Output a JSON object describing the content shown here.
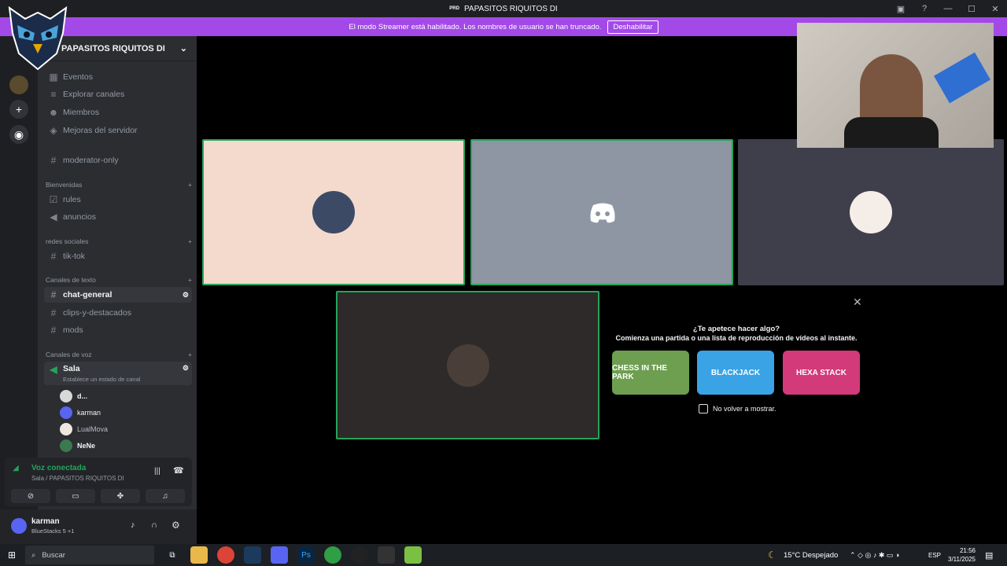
{
  "title": {
    "badge": "PRD",
    "text": "PAPASITOS RIQUITOS DI"
  },
  "streamer": {
    "message": "El modo Streamer está habilitado. Los nombres de usuario se han truncado.",
    "button": "Deshabilitar"
  },
  "server": {
    "name": "PAPASITOS RIQUITOS DI"
  },
  "nav": [
    {
      "label": "Eventos",
      "icon": "calendar-icon"
    },
    {
      "label": "Explorar canales",
      "icon": "list-icon"
    },
    {
      "label": "Miembros",
      "icon": "members-icon"
    },
    {
      "label": "Mejoras del servidor",
      "icon": "boost-icon"
    }
  ],
  "channels": {
    "moderator": "moderator-only",
    "cat_bienvenidas": "Bienvenidas",
    "rules": "rules",
    "anuncios": "anuncios",
    "cat_redes": "redes sociales",
    "tiktok": "tik-tok",
    "cat_texto": "Canales de texto",
    "chat_general": "chat-general",
    "clips": "clips-y-destacados",
    "mods": "mods",
    "cat_voz": "Canales de voz",
    "sala": "Sala",
    "sala_status": "Establece un estado de canal"
  },
  "voice_users": [
    "d...",
    "karman",
    "LualMova",
    "NeNe"
  ],
  "voice_panel": {
    "status": "Voz conectada",
    "location": "Sala / PAPASITOS RIQUITOS DI"
  },
  "user_panel": {
    "name": "karman",
    "activity": "BlueStacks 5 +1"
  },
  "activity": {
    "heading": "¿Te apetece hacer algo?",
    "sub": "Comienza una partida o una lista de reproducción de vídeos al instante.",
    "games": [
      "CHESS IN THE PARK",
      "BLACKJACK",
      "HEXA STACK"
    ],
    "dont_show": "No volver a mostrar."
  },
  "taskbar": {
    "search": "Buscar",
    "weather": "15°C Despejado",
    "lang": "ESP",
    "time": "21:56",
    "date": "3/11/2025"
  },
  "colors": {
    "accent": "#a349e8",
    "speaking": "#23a55a",
    "sidebar": "#2b2d31"
  }
}
